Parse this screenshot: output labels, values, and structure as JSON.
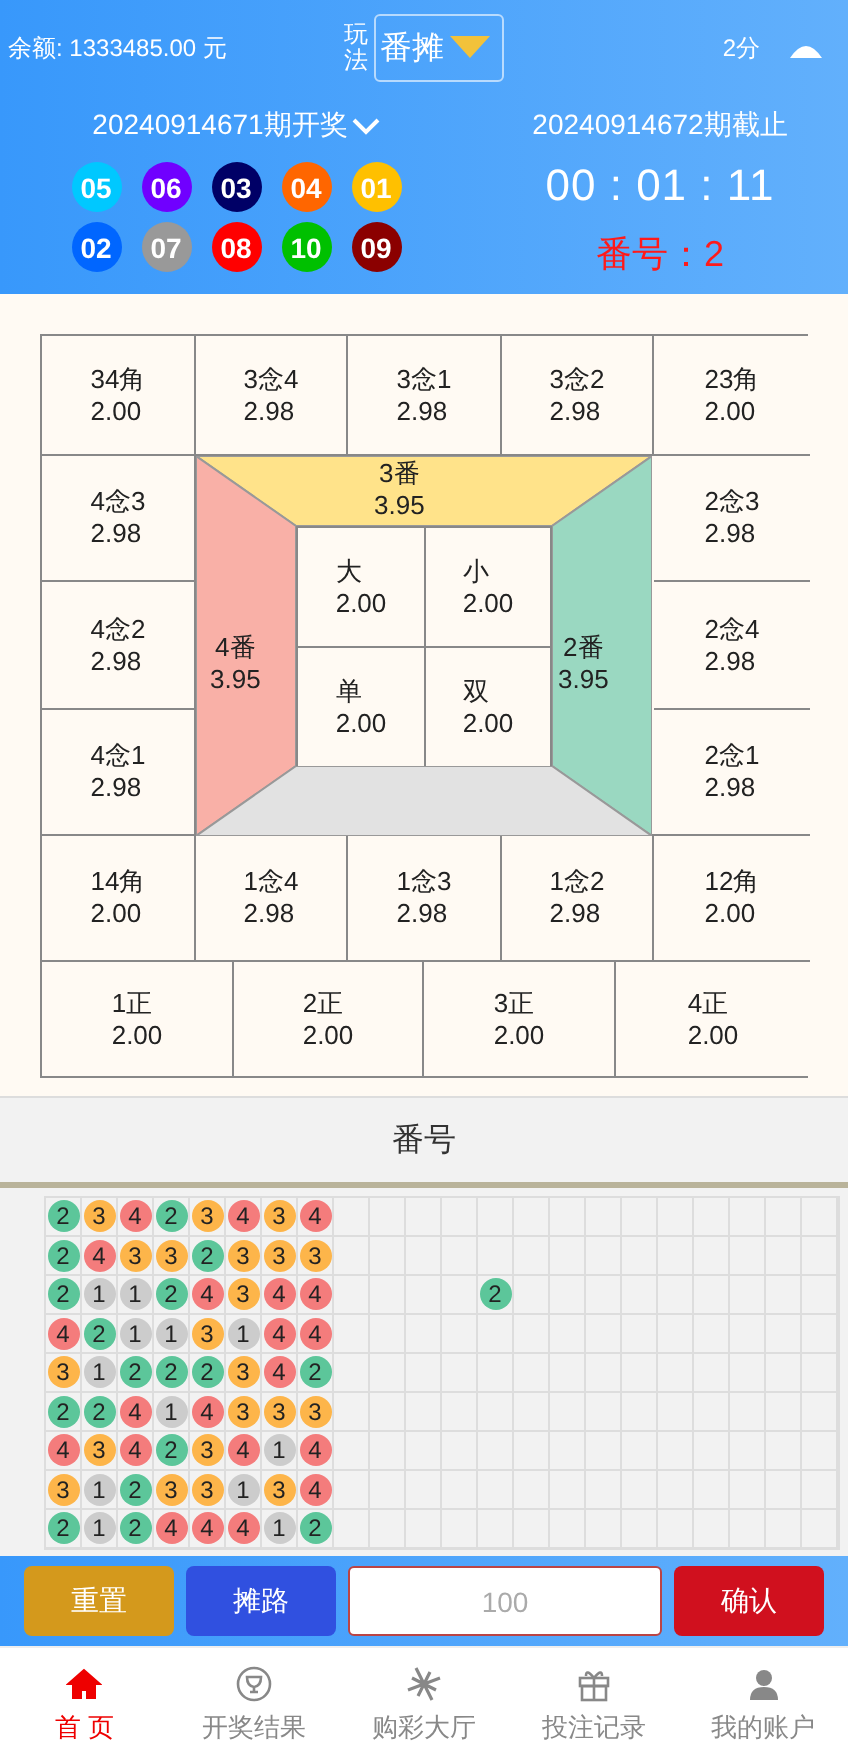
{
  "header": {
    "balance": "余额: 1333485.00 元",
    "play_label": "玩法",
    "play_value": "番摊",
    "interval": "2分"
  },
  "draw": {
    "last_issue": "20240914671期开奖",
    "next_issue": "20240914672期截止",
    "countdown": "00 : 01 : 11",
    "result": "番号：2",
    "balls": [
      {
        "number": "05",
        "color": "#00c8ff"
      },
      {
        "number": "06",
        "color": "#7000ff"
      },
      {
        "number": "03",
        "color": "#000066"
      },
      {
        "number": "04",
        "color": "#ff6600"
      },
      {
        "number": "01",
        "color": "#ffc000"
      },
      {
        "number": "02",
        "color": "#0066ff"
      },
      {
        "number": "07",
        "color": "#999999"
      },
      {
        "number": "08",
        "color": "#ff0000"
      },
      {
        "number": "10",
        "color": "#00c000"
      },
      {
        "number": "09",
        "color": "#8b0000"
      }
    ]
  },
  "board": {
    "top_row": [
      {
        "name": "34角",
        "odds": "2.00"
      },
      {
        "name": "3念4",
        "odds": "2.98"
      },
      {
        "name": "3念1",
        "odds": "2.98"
      },
      {
        "name": "3念2",
        "odds": "2.98"
      },
      {
        "name": "23角",
        "odds": "2.00"
      }
    ],
    "left_column": [
      {
        "name": "4念3",
        "odds": "2.98"
      },
      {
        "name": "4念2",
        "odds": "2.98"
      },
      {
        "name": "4念1",
        "odds": "2.98"
      }
    ],
    "right_column": [
      {
        "name": "2念3",
        "odds": "2.98"
      },
      {
        "name": "2念4",
        "odds": "2.98"
      },
      {
        "name": "2念1",
        "odds": "2.98"
      }
    ],
    "zones": [
      {
        "kind": "top",
        "name": "3番",
        "odds": "3.95",
        "color": "#ffe38a"
      },
      {
        "kind": "left",
        "name": "4番",
        "odds": "3.95",
        "color": "#f9b0a7"
      },
      {
        "kind": "right",
        "name": "2番",
        "odds": "3.95",
        "color": "#9ad8c1"
      },
      {
        "kind": "bottom",
        "color": "#e2e2e2"
      }
    ],
    "center": [
      {
        "name": "大",
        "odds": "2.00"
      },
      {
        "name": "小",
        "odds": "2.00"
      },
      {
        "name": "单",
        "odds": "2.00"
      },
      {
        "name": "双",
        "odds": "2.00"
      }
    ],
    "bottom_row": [
      {
        "name": "14角",
        "odds": "2.00"
      },
      {
        "name": "1念4",
        "odds": "2.98"
      },
      {
        "name": "1念3",
        "odds": "2.98"
      },
      {
        "name": "1念2",
        "odds": "2.98"
      },
      {
        "name": "12角",
        "odds": "2.00"
      }
    ],
    "zheng_row": [
      {
        "name": "1正",
        "odds": "2.00"
      },
      {
        "name": "2正",
        "odds": "2.00"
      },
      {
        "name": "3正",
        "odds": "2.00"
      },
      {
        "name": "4正",
        "odds": "2.00"
      }
    ]
  },
  "road": {
    "title": "番号",
    "rows": [
      [
        {
          "v": "2",
          "color": "#5cc69a"
        },
        {
          "v": "3",
          "color": "#fdb54a"
        },
        {
          "v": "4",
          "color": "#f47c7c"
        },
        {
          "v": "2",
          "color": "#5cc69a"
        },
        {
          "v": "3",
          "color": "#fdb54a"
        },
        {
          "v": "4",
          "color": "#f47c7c"
        },
        {
          "v": "3",
          "color": "#fdb54a"
        },
        {
          "v": "4",
          "color": "#f47c7c"
        }
      ],
      [
        {
          "v": "2",
          "color": "#5cc69a"
        },
        {
          "v": "4",
          "color": "#f47c7c"
        },
        {
          "v": "3",
          "color": "#fdb54a"
        },
        {
          "v": "3",
          "color": "#fdb54a"
        },
        {
          "v": "2",
          "color": "#5cc69a"
        },
        {
          "v": "3",
          "color": "#fdb54a"
        },
        {
          "v": "3",
          "color": "#fdb54a"
        },
        {
          "v": "3",
          "color": "#fdb54a"
        }
      ],
      [
        {
          "v": "2",
          "color": "#5cc69a"
        },
        {
          "v": "1",
          "color": "#cccccc"
        },
        {
          "v": "1",
          "color": "#cccccc"
        },
        {
          "v": "2",
          "color": "#5cc69a"
        },
        {
          "v": "4",
          "color": "#f47c7c"
        },
        {
          "v": "3",
          "color": "#fdb54a"
        },
        {
          "v": "4",
          "color": "#f47c7c"
        },
        {
          "v": "4",
          "color": "#f47c7c"
        },
        null,
        null,
        null,
        null,
        {
          "v": "2",
          "color": "#5cc69a"
        }
      ],
      [
        {
          "v": "4",
          "color": "#f47c7c"
        },
        {
          "v": "2",
          "color": "#5cc69a"
        },
        {
          "v": "1",
          "color": "#cccccc"
        },
        {
          "v": "1",
          "color": "#cccccc"
        },
        {
          "v": "3",
          "color": "#fdb54a"
        },
        {
          "v": "1",
          "color": "#cccccc"
        },
        {
          "v": "4",
          "color": "#f47c7c"
        },
        {
          "v": "4",
          "color": "#f47c7c"
        }
      ],
      [
        {
          "v": "3",
          "color": "#fdb54a"
        },
        {
          "v": "1",
          "color": "#cccccc"
        },
        {
          "v": "2",
          "color": "#5cc69a"
        },
        {
          "v": "2",
          "color": "#5cc69a"
        },
        {
          "v": "2",
          "color": "#5cc69a"
        },
        {
          "v": "3",
          "color": "#fdb54a"
        },
        {
          "v": "4",
          "color": "#f47c7c"
        },
        {
          "v": "2",
          "color": "#5cc69a"
        }
      ],
      [
        {
          "v": "2",
          "color": "#5cc69a"
        },
        {
          "v": "2",
          "color": "#5cc69a"
        },
        {
          "v": "4",
          "color": "#f47c7c"
        },
        {
          "v": "1",
          "color": "#cccccc"
        },
        {
          "v": "4",
          "color": "#f47c7c"
        },
        {
          "v": "3",
          "color": "#fdb54a"
        },
        {
          "v": "3",
          "color": "#fdb54a"
        },
        {
          "v": "3",
          "color": "#fdb54a"
        }
      ],
      [
        {
          "v": "4",
          "color": "#f47c7c"
        },
        {
          "v": "3",
          "color": "#fdb54a"
        },
        {
          "v": "4",
          "color": "#f47c7c"
        },
        {
          "v": "2",
          "color": "#5cc69a"
        },
        {
          "v": "3",
          "color": "#fdb54a"
        },
        {
          "v": "4",
          "color": "#f47c7c"
        },
        {
          "v": "1",
          "color": "#cccccc"
        },
        {
          "v": "4",
          "color": "#f47c7c"
        }
      ],
      [
        {
          "v": "3",
          "color": "#fdb54a"
        },
        {
          "v": "1",
          "color": "#cccccc"
        },
        {
          "v": "2",
          "color": "#5cc69a"
        },
        {
          "v": "3",
          "color": "#fdb54a"
        },
        {
          "v": "3",
          "color": "#fdb54a"
        },
        {
          "v": "1",
          "color": "#cccccc"
        },
        {
          "v": "3",
          "color": "#fdb54a"
        },
        {
          "v": "4",
          "color": "#f47c7c"
        }
      ],
      [
        {
          "v": "2",
          "color": "#5cc69a"
        },
        {
          "v": "1",
          "color": "#cccccc"
        },
        {
          "v": "2",
          "color": "#5cc69a"
        },
        {
          "v": "4",
          "color": "#f47c7c"
        },
        {
          "v": "4",
          "color": "#f47c7c"
        },
        {
          "v": "4",
          "color": "#f47c7c"
        },
        {
          "v": "1",
          "color": "#cccccc"
        },
        {
          "v": "2",
          "color": "#5cc69a"
        }
      ]
    ]
  },
  "actions": {
    "buttons": [
      {
        "label": "重置",
        "color": "#d4991c"
      },
      {
        "label": "摊路",
        "color": "#3050e0"
      }
    ],
    "amount": {
      "placeholder": "100"
    },
    "confirm": {
      "label": "确认",
      "color": "#d0101e"
    }
  },
  "tabs": [
    {
      "kind": "home",
      "label": "首 页",
      "selected": true
    },
    {
      "kind": "trophy",
      "label": "开奖结果",
      "selected": false
    },
    {
      "kind": "pinwheel",
      "label": "购彩大厅",
      "selected": false
    },
    {
      "kind": "gift",
      "label": "投注记录",
      "selected": false
    },
    {
      "kind": "user",
      "label": "我的账户",
      "selected": false
    }
  ]
}
